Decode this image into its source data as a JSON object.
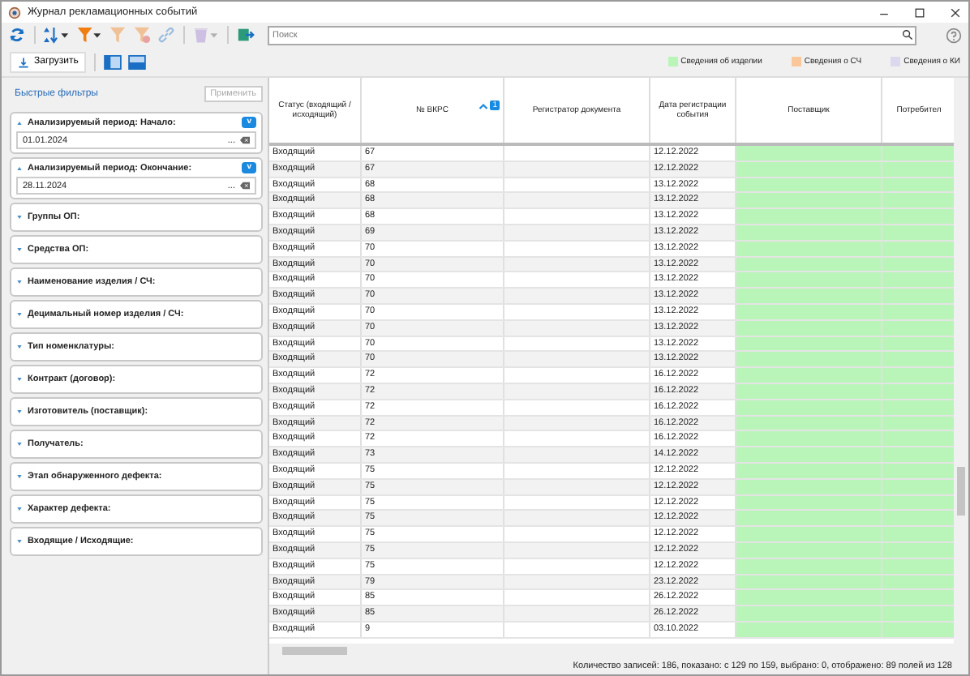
{
  "window": {
    "title": "Журнал рекламационных событий"
  },
  "toolbar": [
    {
      "kind": "refresh",
      "disabled": false
    },
    {
      "kind": "sort",
      "disabled": false
    },
    {
      "kind": "filter",
      "disabled": false
    },
    {
      "kind": "filter",
      "disabled": true
    },
    {
      "kind": "filter-clear",
      "disabled": true
    },
    {
      "kind": "link",
      "disabled": true
    },
    {
      "kind": "trash",
      "disabled": true
    },
    {
      "kind": "export",
      "disabled": false
    }
  ],
  "search": {
    "placeholder": "Поиск"
  },
  "load_button": "Загрузить",
  "legend": [
    {
      "label": "Сведения об изделии",
      "color": "#b9f5b9"
    },
    {
      "label": "Сведения о СЧ",
      "color": "#fbc79a"
    },
    {
      "label": "Сведения о КИ",
      "color": "#dcd8ee"
    }
  ],
  "quick_filters": {
    "title": "Быстрые фильтры",
    "apply_button": "Применить",
    "apply_disabled": true
  },
  "filters": [
    {
      "label": "Анализируемый период: Начало:",
      "expanded": true,
      "badge": "v",
      "value": "01.01.2024",
      "picker": "..."
    },
    {
      "label": "Анализируемый период: Окончание:",
      "expanded": true,
      "badge": "v",
      "value": "28.11.2024",
      "picker": "..."
    },
    {
      "label": "Группы ОП:",
      "expanded": false
    },
    {
      "label": "Средства ОП:",
      "expanded": false
    },
    {
      "label": "Наименование изделия / СЧ:",
      "expanded": false
    },
    {
      "label": "Децимальный номер изделия / СЧ:",
      "expanded": false
    },
    {
      "label": "Тип номенклатуры:",
      "expanded": false
    },
    {
      "label": "Контракт (договор):",
      "expanded": false
    },
    {
      "label": "Изготовитель (поставщик):",
      "expanded": false
    },
    {
      "label": "Получатель:",
      "expanded": false
    },
    {
      "label": "Этап обнаруженного дефекта:",
      "expanded": false
    },
    {
      "label": "Характер дефекта:",
      "expanded": false
    },
    {
      "label": "Входящие / Исходящие:",
      "expanded": false
    }
  ],
  "table": {
    "columns": [
      {
        "label": "Статус (входящий / исходящий)"
      },
      {
        "label": "№ ВКРС",
        "sort_badge": "1"
      },
      {
        "label": "Регистратор документа"
      },
      {
        "label": "Дата регистрации события"
      },
      {
        "label": "Поставщик"
      },
      {
        "label": "Потребител"
      }
    ],
    "rows": [
      [
        "Входящий",
        "67",
        "",
        "12.12.2022"
      ],
      [
        "Входящий",
        "67",
        "",
        "12.12.2022"
      ],
      [
        "Входящий",
        "68",
        "",
        "13.12.2022"
      ],
      [
        "Входящий",
        "68",
        "",
        "13.12.2022"
      ],
      [
        "Входящий",
        "68",
        "",
        "13.12.2022"
      ],
      [
        "Входящий",
        "69",
        "",
        "13.12.2022"
      ],
      [
        "Входящий",
        "70",
        "",
        "13.12.2022"
      ],
      [
        "Входящий",
        "70",
        "",
        "13.12.2022"
      ],
      [
        "Входящий",
        "70",
        "",
        "13.12.2022"
      ],
      [
        "Входящий",
        "70",
        "",
        "13.12.2022"
      ],
      [
        "Входящий",
        "70",
        "",
        "13.12.2022"
      ],
      [
        "Входящий",
        "70",
        "",
        "13.12.2022"
      ],
      [
        "Входящий",
        "70",
        "",
        "13.12.2022"
      ],
      [
        "Входящий",
        "70",
        "",
        "13.12.2022"
      ],
      [
        "Входящий",
        "72",
        "",
        "16.12.2022"
      ],
      [
        "Входящий",
        "72",
        "",
        "16.12.2022"
      ],
      [
        "Входящий",
        "72",
        "",
        "16.12.2022"
      ],
      [
        "Входящий",
        "72",
        "",
        "16.12.2022"
      ],
      [
        "Входящий",
        "72",
        "",
        "16.12.2022"
      ],
      [
        "Входящий",
        "73",
        "",
        "14.12.2022"
      ],
      [
        "Входящий",
        "75",
        "",
        "12.12.2022"
      ],
      [
        "Входящий",
        "75",
        "",
        "12.12.2022"
      ],
      [
        "Входящий",
        "75",
        "",
        "12.12.2022"
      ],
      [
        "Входящий",
        "75",
        "",
        "12.12.2022"
      ],
      [
        "Входящий",
        "75",
        "",
        "12.12.2022"
      ],
      [
        "Входящий",
        "75",
        "",
        "12.12.2022"
      ],
      [
        "Входящий",
        "75",
        "",
        "12.12.2022"
      ],
      [
        "Входящий",
        "79",
        "",
        "23.12.2022"
      ],
      [
        "Входящий",
        "85",
        "",
        "26.12.2022"
      ],
      [
        "Входящий",
        "85",
        "",
        "26.12.2022"
      ],
      [
        "Входящий",
        "9",
        "",
        "03.10.2022"
      ]
    ]
  },
  "status_bar": "Количество записей: 186, показано: с 129 по 159, выбрано: 0, отображено: 89 полей из 128"
}
